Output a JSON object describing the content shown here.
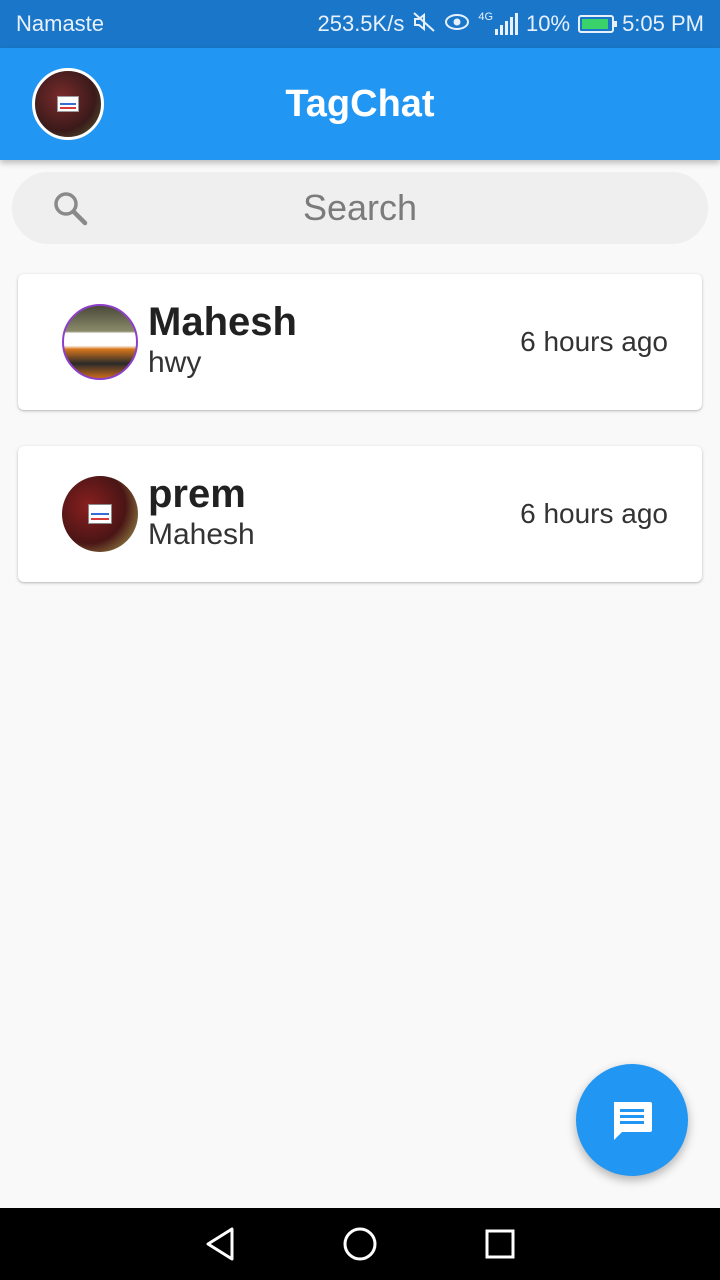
{
  "status_bar": {
    "carrier": "Namaste",
    "network_speed": "253.5K/s",
    "network_type": "4G",
    "battery": "10%",
    "time": "5:05 PM",
    "icons": [
      "mute-icon",
      "eye-icon",
      "signal-icon",
      "battery-charging-icon"
    ]
  },
  "app_bar": {
    "title": "TagChat",
    "profile_avatar": "profile-avatar"
  },
  "search": {
    "placeholder": "Search"
  },
  "chats": [
    {
      "name": "Mahesh",
      "preview": "hwy",
      "time": "6 hours ago"
    },
    {
      "name": "prem",
      "preview": "Mahesh",
      "time": "6 hours ago"
    }
  ],
  "fab": {
    "icon": "message-icon"
  },
  "nav": {
    "icons": [
      "back-icon",
      "home-icon",
      "recents-icon"
    ]
  },
  "colors": {
    "primary": "#2196f3",
    "status_bar": "#1976c9",
    "background": "#f9f9f9"
  }
}
